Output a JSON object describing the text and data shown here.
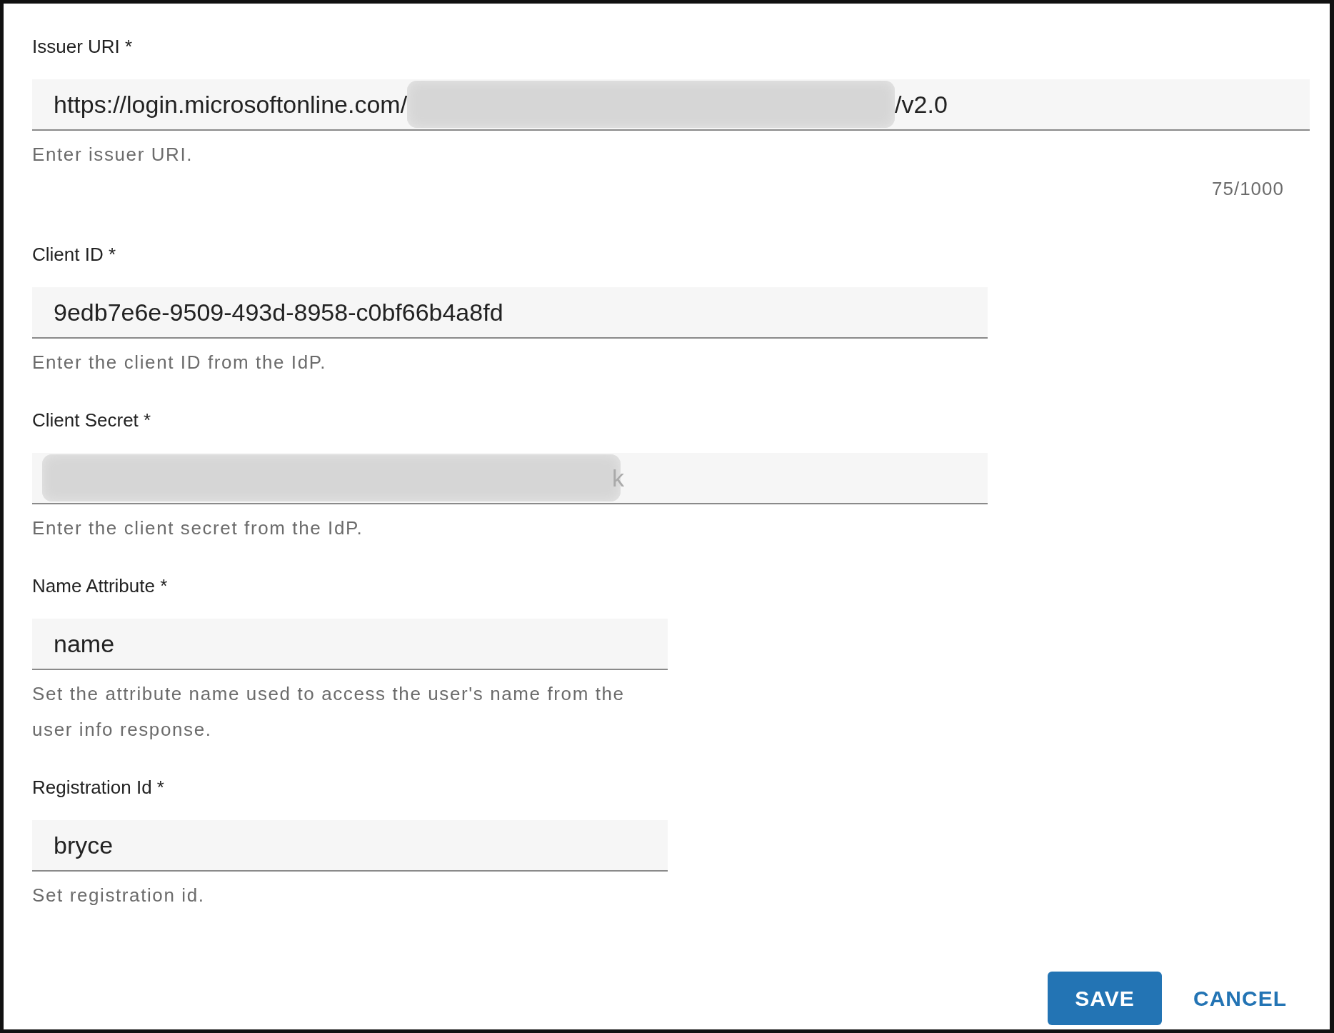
{
  "fields": [
    {
      "label": "Issuer URI *",
      "value_start": "https://login.microsoftonline.com/",
      "redacted": true,
      "value_end": "/v2.0",
      "helper": "Enter issuer URI.",
      "counter": "75/1000"
    },
    {
      "label": "Client ID *",
      "value_start": "9edb7e6e-9509-493d-8958-c0bf66b4a8fd",
      "redacted": false,
      "helper": "Enter the client ID from the IdP."
    },
    {
      "label": "Client Secret *",
      "redacted": true,
      "value_end": "k",
      "helper": "Enter the client secret from the IdP."
    },
    {
      "label": "Name Attribute *",
      "value_start": "name",
      "redacted": false,
      "helper": "Set the attribute name used to access the user's name from the user info response."
    },
    {
      "label": "Registration Id *",
      "value_start": "bryce",
      "redacted": false,
      "helper": "Set registration id."
    }
  ],
  "buttons": [
    {
      "label": "SAVE",
      "kind": "primary"
    },
    {
      "label": "CANCEL",
      "kind": "text"
    }
  ]
}
